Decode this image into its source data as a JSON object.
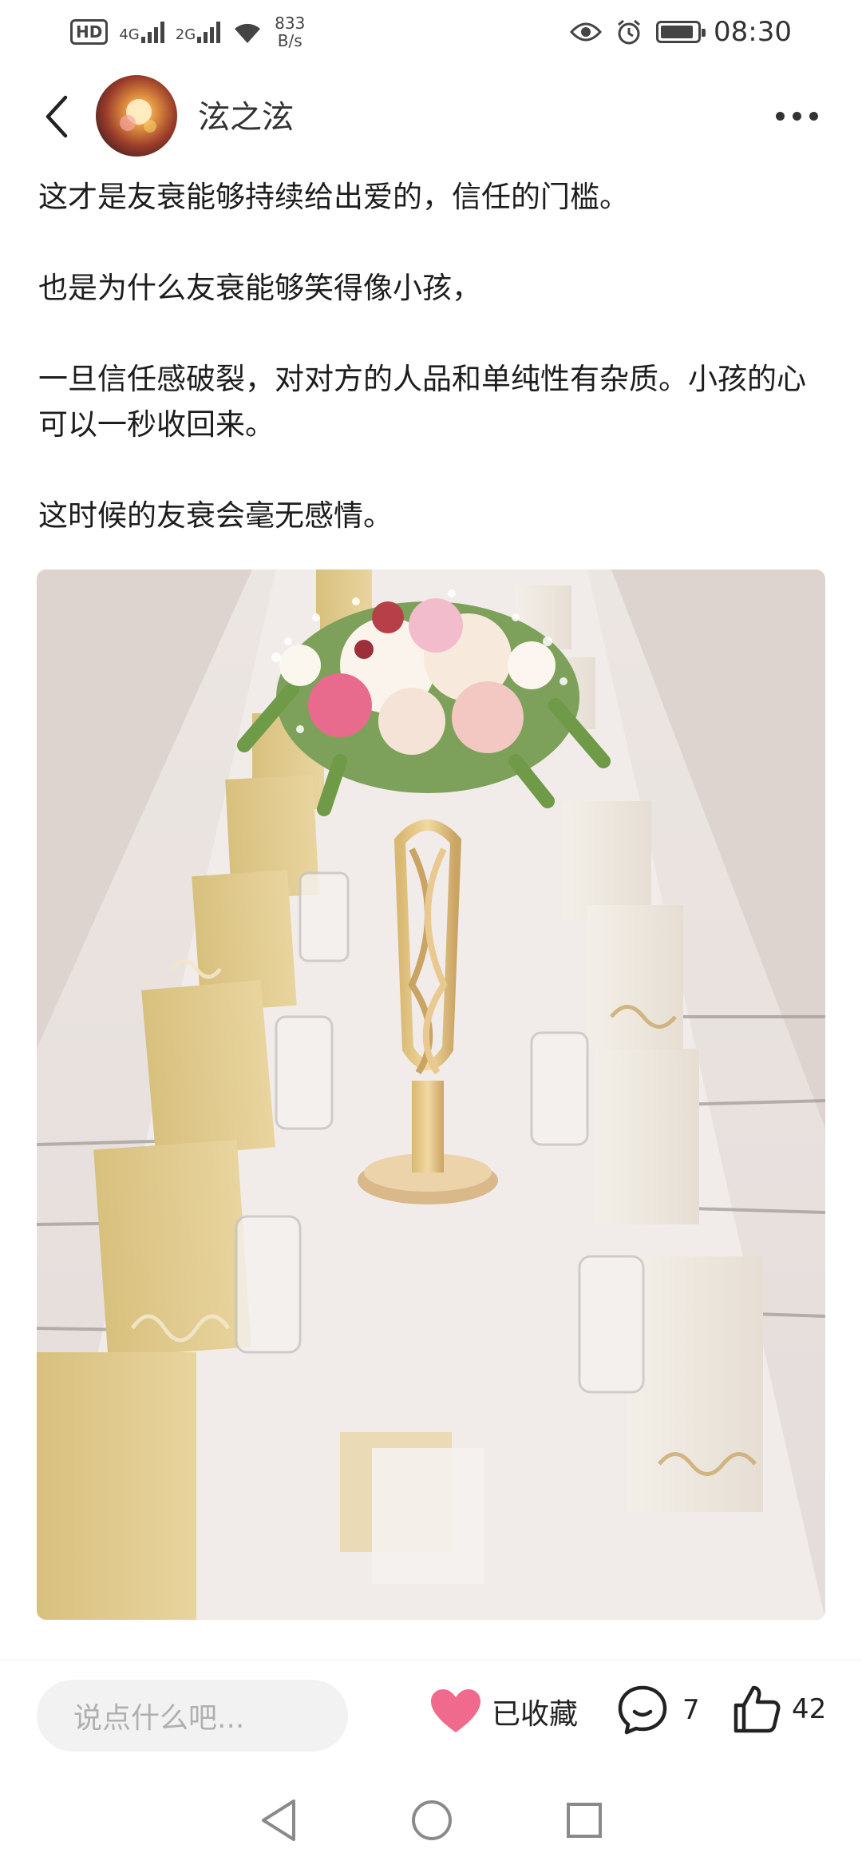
{
  "status_bar": {
    "hd": "HD",
    "net1": "4G",
    "net2": "2G",
    "rate_value": "833",
    "rate_unit": "B/s",
    "time": "08:30"
  },
  "header": {
    "author": "泫之泫"
  },
  "post": {
    "paragraphs": [
      "这才是友衰能够持续给出爱的，信任的门槛。",
      "也是为什么友衰能够笑得像小孩，",
      "一旦信任感破裂，对对方的人品和单纯性有杂质。小孩的心可以一秒收回来。",
      "这时候的友衰会毫无感情。"
    ]
  },
  "bottom_bar": {
    "comment_placeholder": "说点什么吧...",
    "favorite_label": "已收藏",
    "comment_count": "7",
    "like_count": "42",
    "favorite_color": "#f06a8e"
  }
}
